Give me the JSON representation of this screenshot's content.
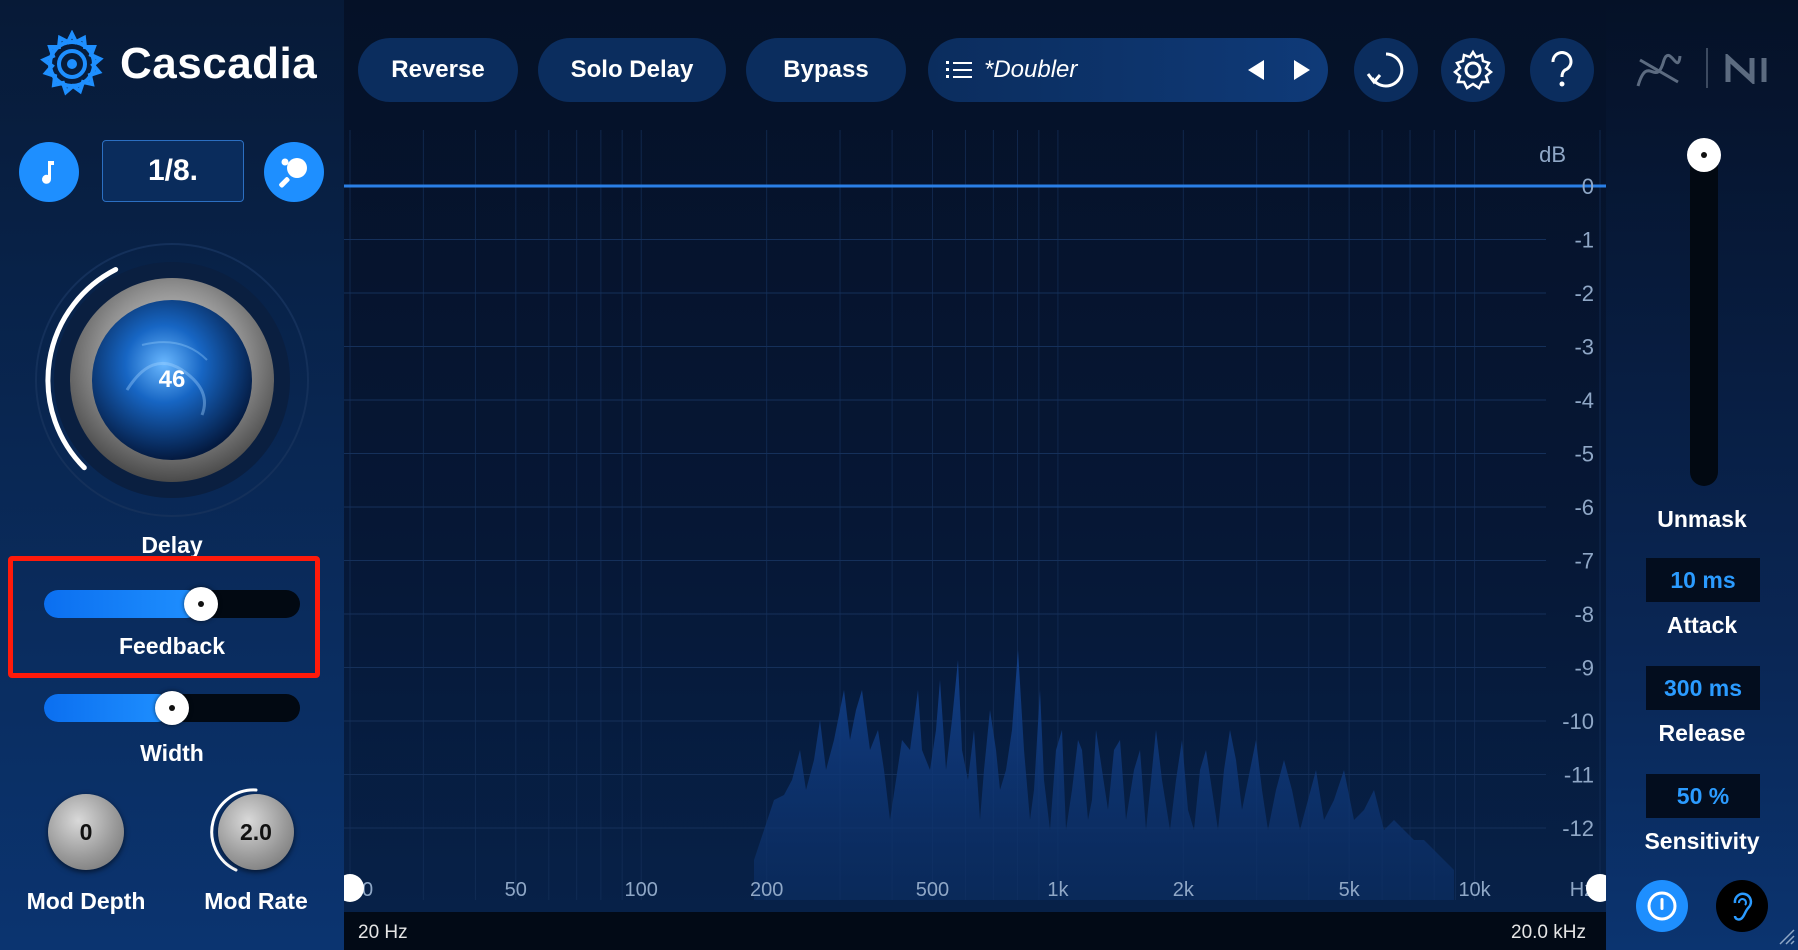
{
  "app": {
    "name": "Cascadia"
  },
  "toolbar": {
    "reverse_label": "Reverse",
    "solo_delay_label": "Solo Delay",
    "bypass_label": "Bypass",
    "preset_name": "*Doubler"
  },
  "left": {
    "time_division": "1/8.",
    "delay": {
      "label": "Delay",
      "value": "46"
    },
    "feedback": {
      "label": "Feedback",
      "level": 0.63
    },
    "width": {
      "label": "Width",
      "level": 0.5
    },
    "mod_depth": {
      "label": "Mod Depth",
      "value": "0"
    },
    "mod_rate": {
      "label": "Mod Rate",
      "value": "2.0"
    }
  },
  "spectrum": {
    "db_unit": "dB",
    "db_ticks": [
      "0",
      "-1",
      "-2",
      "-3",
      "-4",
      "-5",
      "-6",
      "-7",
      "-8",
      "-9",
      "-10",
      "-11",
      "-12"
    ],
    "freq_ticks": [
      "20",
      "50",
      "100",
      "200",
      "500",
      "1k",
      "2k",
      "5k",
      "10k",
      "Hz"
    ],
    "freq_ticks_hz": [
      20,
      50,
      100,
      200,
      500,
      1000,
      2000,
      5000,
      10000,
      20000
    ],
    "range_low": "20 Hz",
    "range_high": "20.0 kHz"
  },
  "right": {
    "unmask": {
      "label": "Unmask",
      "level": 1.0
    },
    "attack": {
      "label": "Attack",
      "value": "10 ms"
    },
    "release": {
      "label": "Release",
      "value": "300 ms"
    },
    "sensitivity": {
      "label": "Sensitivity",
      "value": "50 %"
    }
  },
  "colors": {
    "accent": "#1e8fff",
    "highlight": "#ff1a0a",
    "line": "#2a7fe6"
  }
}
